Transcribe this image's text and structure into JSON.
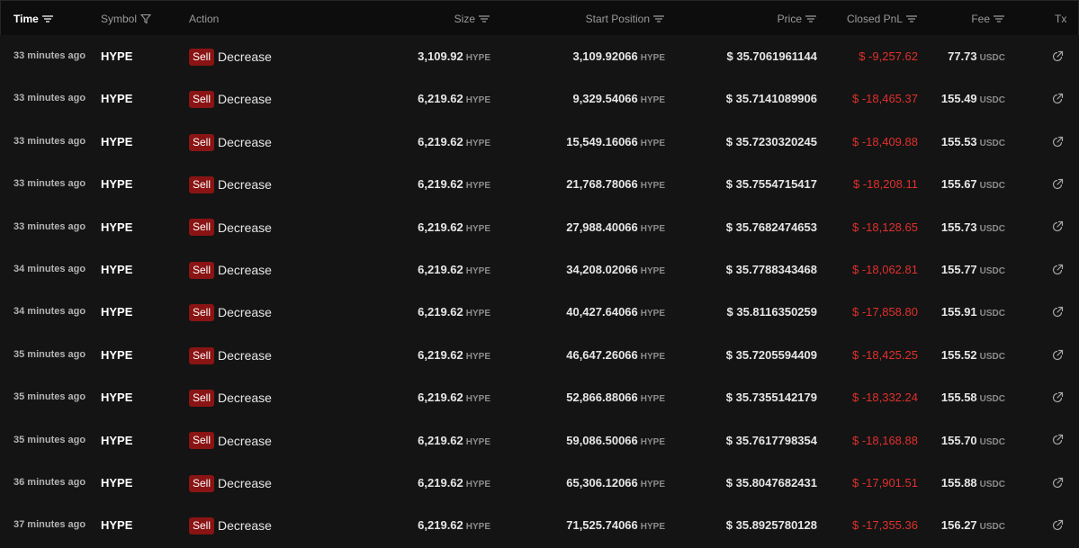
{
  "headers": {
    "time": "Time",
    "symbol": "Symbol",
    "action": "Action",
    "size": "Size",
    "start_position": "Start Position",
    "price": "Price",
    "closed_pnl": "Closed PnL",
    "fee": "Fee",
    "tx": "Tx"
  },
  "icons": {
    "sort": "sort-lines-icon",
    "filter": "filter-funnel-icon",
    "tx_link": "external-link-icon"
  },
  "colors": {
    "sell_badge": "#8a1414",
    "negative_pnl": "#e0302c",
    "background": "#141414",
    "header_background": "#0d0d0d"
  },
  "rows": [
    {
      "time": "33 minutes ago",
      "symbol": "HYPE",
      "side": "Sell",
      "direction": "Decrease",
      "size": "3,109.92",
      "size_unit": "HYPE",
      "start_position": "3,109.92066",
      "start_unit": "HYPE",
      "price": "$ 35.7061961144",
      "closed_pnl": "$ -9,257.62",
      "fee": "77.73",
      "fee_unit": "USDC"
    },
    {
      "time": "33 minutes ago",
      "symbol": "HYPE",
      "side": "Sell",
      "direction": "Decrease",
      "size": "6,219.62",
      "size_unit": "HYPE",
      "start_position": "9,329.54066",
      "start_unit": "HYPE",
      "price": "$ 35.7141089906",
      "closed_pnl": "$ -18,465.37",
      "fee": "155.49",
      "fee_unit": "USDC"
    },
    {
      "time": "33 minutes ago",
      "symbol": "HYPE",
      "side": "Sell",
      "direction": "Decrease",
      "size": "6,219.62",
      "size_unit": "HYPE",
      "start_position": "15,549.16066",
      "start_unit": "HYPE",
      "price": "$ 35.7230320245",
      "closed_pnl": "$ -18,409.88",
      "fee": "155.53",
      "fee_unit": "USDC"
    },
    {
      "time": "33 minutes ago",
      "symbol": "HYPE",
      "side": "Sell",
      "direction": "Decrease",
      "size": "6,219.62",
      "size_unit": "HYPE",
      "start_position": "21,768.78066",
      "start_unit": "HYPE",
      "price": "$ 35.7554715417",
      "closed_pnl": "$ -18,208.11",
      "fee": "155.67",
      "fee_unit": "USDC"
    },
    {
      "time": "33 minutes ago",
      "symbol": "HYPE",
      "side": "Sell",
      "direction": "Decrease",
      "size": "6,219.62",
      "size_unit": "HYPE",
      "start_position": "27,988.40066",
      "start_unit": "HYPE",
      "price": "$ 35.7682474653",
      "closed_pnl": "$ -18,128.65",
      "fee": "155.73",
      "fee_unit": "USDC"
    },
    {
      "time": "34 minutes ago",
      "symbol": "HYPE",
      "side": "Sell",
      "direction": "Decrease",
      "size": "6,219.62",
      "size_unit": "HYPE",
      "start_position": "34,208.02066",
      "start_unit": "HYPE",
      "price": "$ 35.7788343468",
      "closed_pnl": "$ -18,062.81",
      "fee": "155.77",
      "fee_unit": "USDC"
    },
    {
      "time": "34 minutes ago",
      "symbol": "HYPE",
      "side": "Sell",
      "direction": "Decrease",
      "size": "6,219.62",
      "size_unit": "HYPE",
      "start_position": "40,427.64066",
      "start_unit": "HYPE",
      "price": "$ 35.8116350259",
      "closed_pnl": "$ -17,858.80",
      "fee": "155.91",
      "fee_unit": "USDC"
    },
    {
      "time": "35 minutes ago",
      "symbol": "HYPE",
      "side": "Sell",
      "direction": "Decrease",
      "size": "6,219.62",
      "size_unit": "HYPE",
      "start_position": "46,647.26066",
      "start_unit": "HYPE",
      "price": "$ 35.7205594409",
      "closed_pnl": "$ -18,425.25",
      "fee": "155.52",
      "fee_unit": "USDC"
    },
    {
      "time": "35 minutes ago",
      "symbol": "HYPE",
      "side": "Sell",
      "direction": "Decrease",
      "size": "6,219.62",
      "size_unit": "HYPE",
      "start_position": "52,866.88066",
      "start_unit": "HYPE",
      "price": "$ 35.7355142179",
      "closed_pnl": "$ -18,332.24",
      "fee": "155.58",
      "fee_unit": "USDC"
    },
    {
      "time": "35 minutes ago",
      "symbol": "HYPE",
      "side": "Sell",
      "direction": "Decrease",
      "size": "6,219.62",
      "size_unit": "HYPE",
      "start_position": "59,086.50066",
      "start_unit": "HYPE",
      "price": "$ 35.7617798354",
      "closed_pnl": "$ -18,168.88",
      "fee": "155.70",
      "fee_unit": "USDC"
    },
    {
      "time": "36 minutes ago",
      "symbol": "HYPE",
      "side": "Sell",
      "direction": "Decrease",
      "size": "6,219.62",
      "size_unit": "HYPE",
      "start_position": "65,306.12066",
      "start_unit": "HYPE",
      "price": "$ 35.8047682431",
      "closed_pnl": "$ -17,901.51",
      "fee": "155.88",
      "fee_unit": "USDC"
    },
    {
      "time": "37 minutes ago",
      "symbol": "HYPE",
      "side": "Sell",
      "direction": "Decrease",
      "size": "6,219.62",
      "size_unit": "HYPE",
      "start_position": "71,525.74066",
      "start_unit": "HYPE",
      "price": "$ 35.8925780128",
      "closed_pnl": "$ -17,355.36",
      "fee": "156.27",
      "fee_unit": "USDC"
    }
  ]
}
